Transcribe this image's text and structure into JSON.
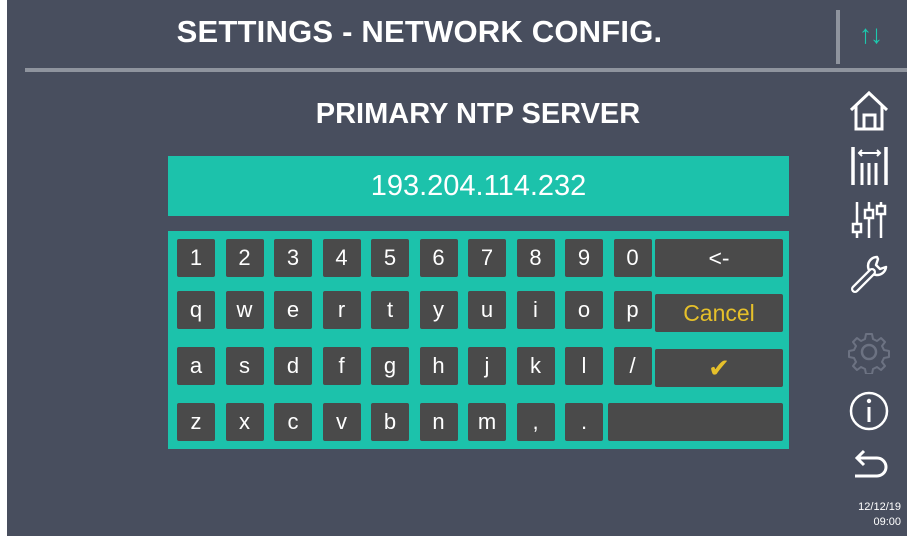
{
  "header": {
    "title": "SETTINGS - NETWORK CONFIG.",
    "arrows_icon": "up-down-arrows",
    "arrows_glyph": "↑↓"
  },
  "field": {
    "label": "PRIMARY NTP SERVER",
    "value": "193.204.114.232"
  },
  "keyboard": {
    "row1": [
      "1",
      "2",
      "3",
      "4",
      "5",
      "6",
      "7",
      "8",
      "9",
      "0"
    ],
    "row2": [
      "q",
      "w",
      "e",
      "r",
      "t",
      "y",
      "u",
      "i",
      "o",
      "p"
    ],
    "row3": [
      "a",
      "s",
      "d",
      "f",
      "g",
      "h",
      "j",
      "k",
      "l",
      "/"
    ],
    "row4": [
      "z",
      "x",
      "c",
      "v",
      "b",
      "n",
      "m",
      ",",
      "."
    ],
    "backspace_label": "<-",
    "cancel_label": "Cancel",
    "confirm_glyph": "✔",
    "space_label": ""
  },
  "sidebar": {
    "icons": [
      "home-icon",
      "calibration-icon",
      "sliders-icon",
      "wrench-icon",
      "gear-icon",
      "info-icon",
      "back-icon"
    ]
  },
  "status": {
    "date": "12/12/19",
    "time": "09:00"
  },
  "colors": {
    "background": "#484e5e",
    "accent": "#1cc2ab",
    "key": "#4a4a4a",
    "highlight": "#e6c02a",
    "disabled": "#6c7282"
  }
}
